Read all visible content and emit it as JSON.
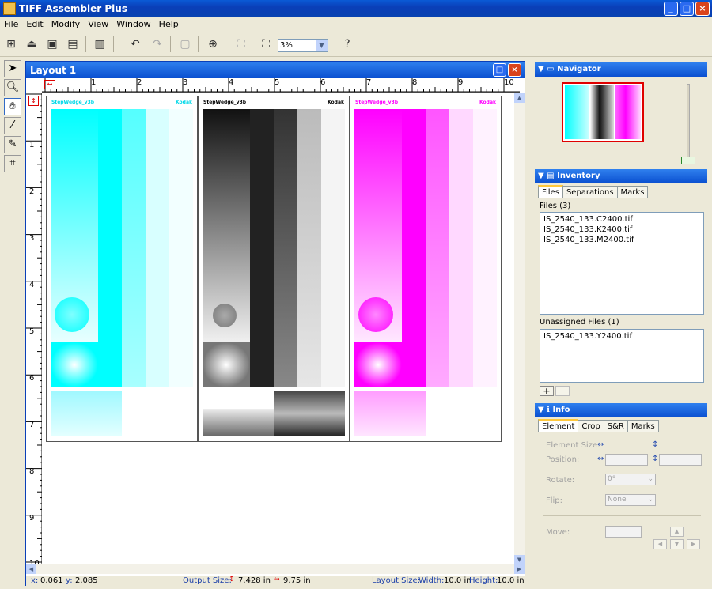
{
  "app": {
    "title": "TIFF Assembler Plus"
  },
  "menu": [
    "File",
    "Edit",
    "Modify",
    "View",
    "Window",
    "Help"
  ],
  "toolbar": {
    "zoom": "3%"
  },
  "document": {
    "title": "Layout 1",
    "hruler_numbers": [
      "1",
      "2",
      "3",
      "4",
      "5",
      "6",
      "7",
      "8",
      "9",
      "10"
    ],
    "vruler_numbers": [
      "1",
      "2",
      "3",
      "4",
      "5",
      "6",
      "7",
      "8",
      "9",
      "10"
    ],
    "pages": [
      {
        "label": "StepWedge_v3b",
        "brand": "Kodak",
        "color": "#00ffff"
      },
      {
        "label": "StepWedge_v3b",
        "brand": "Kodak",
        "color": "#000000"
      },
      {
        "label": "StepWedge_v3b",
        "brand": "Kodak",
        "color": "#ff00ff"
      }
    ]
  },
  "status": {
    "x_label": "x:",
    "x": "0.061",
    "y_label": "y:",
    "y": "2.085",
    "output_label": "Output Size:",
    "output_h": "7.428 in",
    "output_w": "9.75 in",
    "layout_label": "Layout Size:",
    "width_label": "Width:",
    "width": "10.0 in",
    "height_label": "Height:",
    "height": "10.0 in"
  },
  "navigator": {
    "title": "Navigator"
  },
  "inventory": {
    "title": "Inventory",
    "tabs": [
      "Files",
      "Separations",
      "Marks"
    ],
    "files_header": "Files (3)",
    "files": [
      "IS_2540_133.C2400.tif",
      "IS_2540_133.K2400.tif",
      "IS_2540_133.M2400.tif"
    ],
    "unassigned_header": "Unassigned Files (1)",
    "unassigned": [
      "IS_2540_133.Y2400.tif"
    ],
    "add": "+",
    "remove": "−"
  },
  "info": {
    "title": "Info",
    "tabs": [
      "Element",
      "Crop",
      "S&R",
      "Marks"
    ],
    "element_size": "Element Size:",
    "position": "Position:",
    "rotate": "Rotate:",
    "rotate_value": "0°",
    "flip": "Flip:",
    "flip_value": "None",
    "move": "Move:"
  },
  "colors": {
    "titlebar": "#0a4fd0",
    "cyan": "#00ffff",
    "magenta": "#ff00ff",
    "nav_frame": "#e00000"
  }
}
